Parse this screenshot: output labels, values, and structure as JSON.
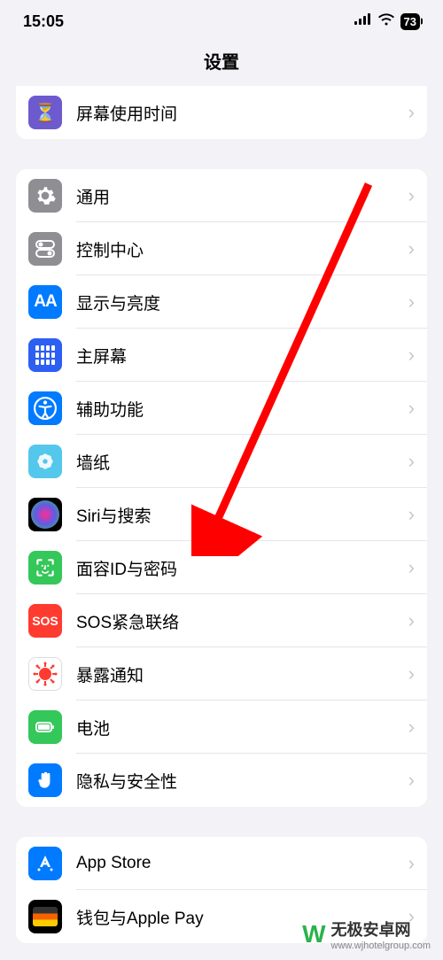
{
  "status": {
    "time": "15:05",
    "battery": "73"
  },
  "header": {
    "title": "设置"
  },
  "group0": {
    "items": [
      {
        "label": "屏幕使用时间"
      }
    ]
  },
  "group1": {
    "items": [
      {
        "label": "通用"
      },
      {
        "label": "控制中心"
      },
      {
        "label": "显示与亮度"
      },
      {
        "label": "主屏幕"
      },
      {
        "label": "辅助功能"
      },
      {
        "label": "墙纸"
      },
      {
        "label": "Siri与搜索"
      },
      {
        "label": "面容ID与密码"
      },
      {
        "label": "SOS紧急联络"
      },
      {
        "label": "暴露通知"
      },
      {
        "label": "电池"
      },
      {
        "label": "隐私与安全性"
      }
    ]
  },
  "group2": {
    "items": [
      {
        "label": "App Store"
      },
      {
        "label": "钱包与Apple Pay"
      }
    ]
  },
  "icons": {
    "aa": "AA",
    "sos": "SOS"
  },
  "watermark": {
    "main": "无极安卓网",
    "sub": "www.wjhotelgroup.com"
  },
  "colors": {
    "arrow": "#ff0000"
  }
}
